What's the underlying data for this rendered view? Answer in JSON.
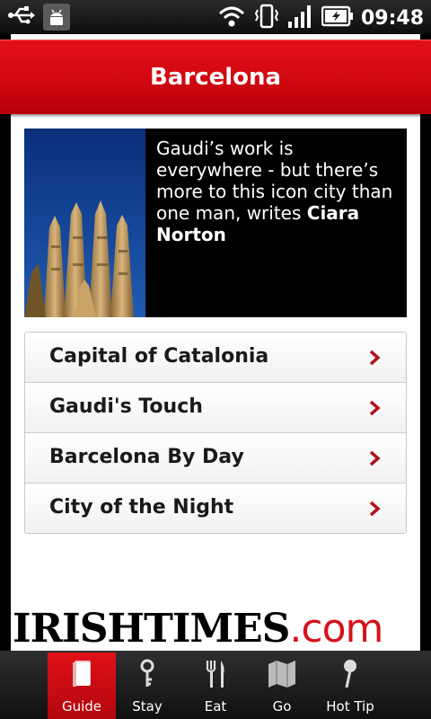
{
  "status_bar": {
    "time": "09:48"
  },
  "header": {
    "title": "Barcelona"
  },
  "feature": {
    "text": "Gaudi’s work is everywhere - but there’s more to this icon city than one man, writes",
    "author": "Ciara Norton"
  },
  "menu": {
    "items": [
      {
        "label": "Capital of Catalonia"
      },
      {
        "label": "Gaudi's Touch"
      },
      {
        "label": "Barcelona By Day"
      },
      {
        "label": "City of the Night"
      }
    ]
  },
  "logo": {
    "main": "IRISHTIMES",
    "suffix": ".com"
  },
  "tabs": [
    {
      "label": "Guide",
      "icon": "book-icon",
      "active": true
    },
    {
      "label": "Stay",
      "icon": "key-icon",
      "active": false
    },
    {
      "label": "Eat",
      "icon": "fork-knife-icon",
      "active": false
    },
    {
      "label": "Go",
      "icon": "map-icon",
      "active": false
    },
    {
      "label": "Hot Tip",
      "icon": "pin-icon",
      "active": false
    }
  ],
  "colors": {
    "brand_red": "#d00810",
    "logo_red": "#d5121a"
  }
}
